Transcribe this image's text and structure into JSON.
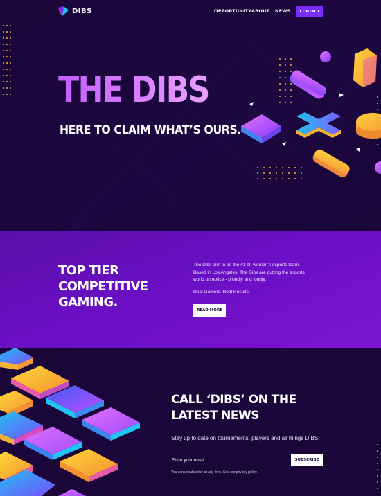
{
  "nav": {
    "logo_text": "DIBS",
    "links": [
      "OPPORTUNITY",
      "ABOUT",
      "NEWS"
    ],
    "contact_label": "CONTACT"
  },
  "hero": {
    "title": "THE DIBS",
    "subtitle": "HERE TO CLAIM WHAT’S OURS."
  },
  "feature": {
    "title": "TOP TIER COMPETITIVE GAMING.",
    "body": "The Dibs aim to be the #1 all-women’s esports team. Based in Los Angeles, The Dibs are putting the esports world on notice - proudly and loudly.",
    "tagline": "Real Gamers. Real Results.",
    "button_label": "READ MORE"
  },
  "newsletter": {
    "title": "CALL ‘DIBS’ ON THE LATEST NEWS",
    "description": "Stay up to date on tournaments, players and all things DIBS.",
    "email_placeholder": "Enter your email",
    "button_label": "SUBSCRIBE",
    "fine_print": "You can unsubscribe at any time. See our privacy policy."
  },
  "colors": {
    "background": "#1a0638",
    "accent": "#7a2cff",
    "band": "#6a0fc4",
    "gold": "#f2b233",
    "pink": "#c45cff",
    "cyan": "#22c3f0"
  },
  "icons": [
    "dibs-logo-icon"
  ]
}
